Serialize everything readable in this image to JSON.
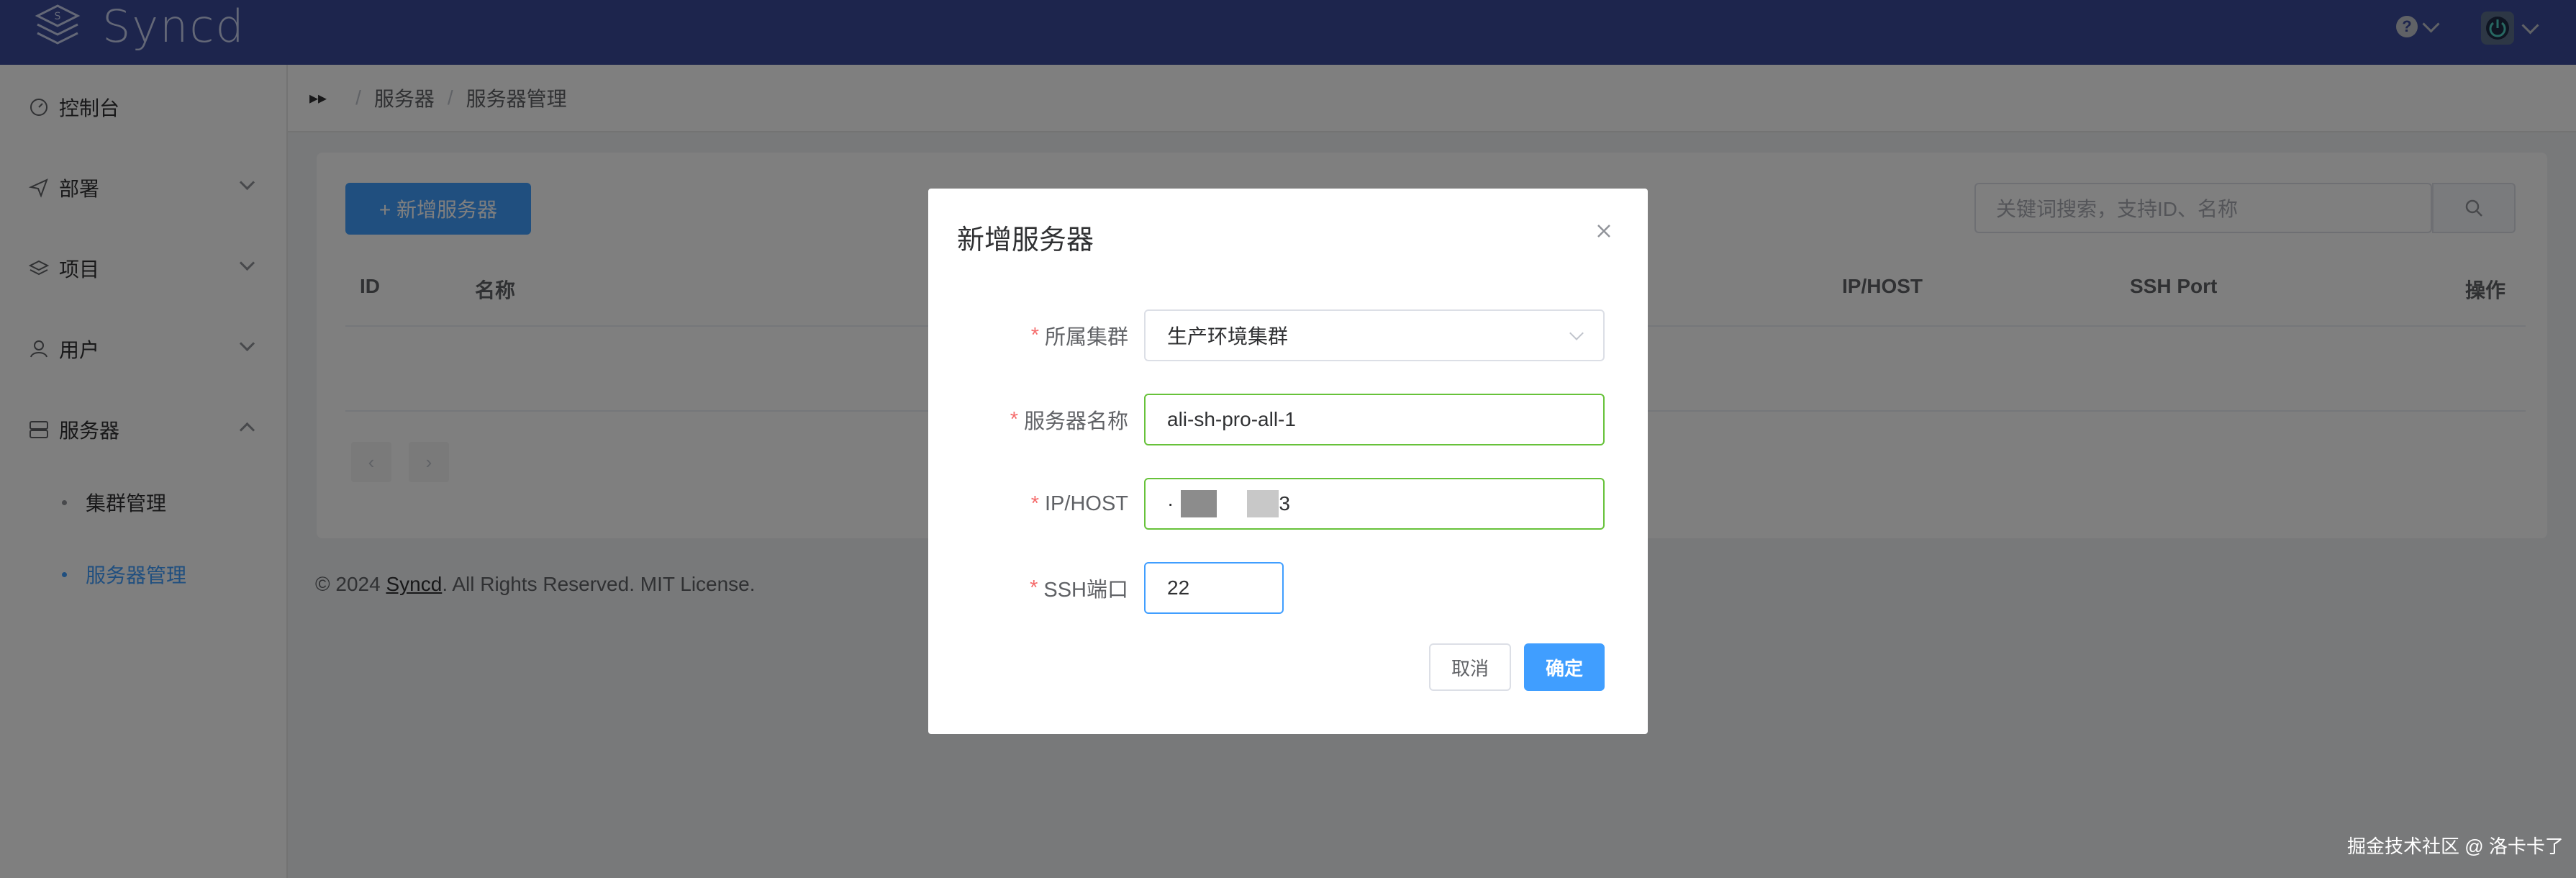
{
  "header": {
    "brand": "Syncd"
  },
  "sidebar": {
    "items": [
      {
        "label": "控制台",
        "icon": "dashboard-icon"
      },
      {
        "label": "部署",
        "icon": "send-icon"
      },
      {
        "label": "项目",
        "icon": "layers-icon"
      },
      {
        "label": "用户",
        "icon": "user-icon"
      },
      {
        "label": "服务器",
        "icon": "server-icon"
      }
    ],
    "sub_items": [
      {
        "label": "集群管理",
        "active": false
      },
      {
        "label": "服务器管理",
        "active": true
      }
    ]
  },
  "breadcrumb": {
    "items": [
      "服务器",
      "服务器管理"
    ],
    "separator": "/"
  },
  "toolbar": {
    "add_label": "+ 新增服务器",
    "search_placeholder": "关键词搜索，支持ID、名称"
  },
  "table": {
    "columns": [
      "ID",
      "名称",
      "IP/HOST",
      "SSH Port",
      "操作"
    ]
  },
  "footer": {
    "prefix": "© 2024 ",
    "link": "Syncd",
    "suffix": ". All Rights Reserved. MIT License."
  },
  "dialog": {
    "title": "新增服务器",
    "fields": [
      {
        "label": "所属集群",
        "value": "生产环境集群",
        "type": "select"
      },
      {
        "label": "服务器名称",
        "value": "ali-sh-pro-all-1",
        "type": "text"
      },
      {
        "label": "IP/HOST",
        "value_start": "·",
        "value_end": "3",
        "type": "text"
      },
      {
        "label": "SSH端口",
        "value": "22",
        "type": "text"
      }
    ],
    "cancel_label": "取消",
    "ok_label": "确定"
  },
  "watermark": "掘金技术社区 @ 洛卡卡了",
  "colors": {
    "header_bg": "#3a4a9b",
    "primary": "#409eff",
    "success": "#67c23a",
    "required": "#f56c6c"
  }
}
